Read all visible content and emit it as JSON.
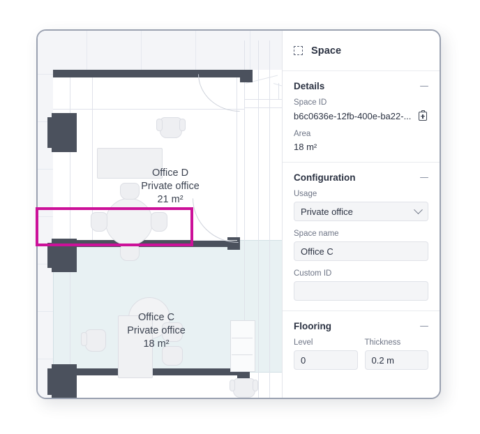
{
  "panel": {
    "header": {
      "title": "Space",
      "icon": "space-dashed-square-icon"
    },
    "sections": [
      {
        "title": "Details",
        "fields": [
          {
            "label": "Space ID",
            "value": "b6c0636e-12fb-400e-ba22-...",
            "icon": "copy-clipboard-icon"
          },
          {
            "label": "Area",
            "value": "18 m²"
          }
        ]
      },
      {
        "title": "Configuration",
        "fields": [
          {
            "label": "Usage",
            "value": "Private office",
            "type": "select"
          },
          {
            "label": "Space name",
            "value": "Office C",
            "type": "text"
          },
          {
            "label": "Custom ID",
            "value": "",
            "type": "text"
          }
        ]
      },
      {
        "title": "Flooring",
        "fields": [
          {
            "label": "Level",
            "value": "0",
            "type": "text"
          },
          {
            "label": "Thickness",
            "value": "0.2 m",
            "type": "text"
          }
        ]
      }
    ]
  },
  "floorplan": {
    "rooms": [
      {
        "name": "Office D",
        "usage": "Private office",
        "area": "21 m²",
        "selected": false
      },
      {
        "name": "Office C",
        "usage": "Private office",
        "area": "18 m²",
        "selected": true
      }
    ]
  },
  "colors": {
    "highlight": "#cc1199",
    "wall": "#4b515d",
    "selection_tint": "#e8f1f3",
    "text": "#2b3242",
    "label": "#6d7485"
  }
}
